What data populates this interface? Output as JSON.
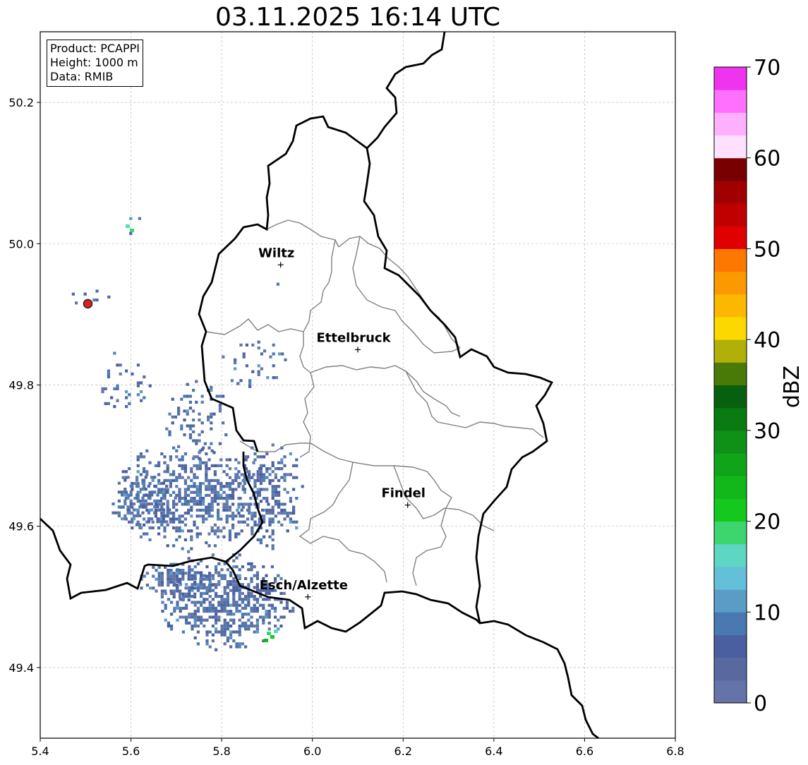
{
  "title": "03.11.2025 16:14 UTC",
  "info": {
    "product": "Product: PCAPPI",
    "height": "Height: 1000 m",
    "data": "Data: RMIB"
  },
  "map": {
    "lon_range": [
      5.4,
      6.8
    ],
    "lat_range": [
      49.3,
      50.3
    ],
    "x_ticks": [
      "5.4",
      "5.6",
      "5.8",
      "6.0",
      "6.2",
      "6.4",
      "6.6",
      "6.8"
    ],
    "y_ticks": [
      "49.4",
      "49.6",
      "49.8",
      "50.0",
      "50.2"
    ],
    "grid": true,
    "cities": [
      {
        "name": "Wiltz",
        "lon": 5.93,
        "lat": 49.97
      },
      {
        "name": "Ettelbruck",
        "lon": 6.1,
        "lat": 49.85
      },
      {
        "name": "Findel",
        "lon": 6.21,
        "lat": 49.63
      },
      {
        "name": "Esch/Alzette",
        "lon": 5.99,
        "lat": 49.5
      }
    ],
    "radar_site": {
      "lon": 5.505,
      "lat": 49.915
    }
  },
  "colorbar": {
    "label": "dBZ",
    "ticks": [
      "0",
      "10",
      "20",
      "30",
      "40",
      "50",
      "60",
      "70"
    ],
    "range": [
      0,
      70
    ],
    "colors": [
      "#6474a8",
      "#5869a0",
      "#495fa0",
      "#4a78b0",
      "#5b9cc6",
      "#63c0d8",
      "#5ed6c3",
      "#3dd66e",
      "#14c81e",
      "#12b81a",
      "#10a418",
      "#0f9016",
      "#0a7a12",
      "#07600e",
      "#497a08",
      "#b0b008",
      "#fcd800",
      "#fcb800",
      "#fc9800",
      "#fc7800",
      "#e00000",
      "#c00000",
      "#a00000",
      "#780000",
      "#ffe0ff",
      "#ffb0ff",
      "#ff70ff",
      "#ee34ee"
    ]
  }
}
